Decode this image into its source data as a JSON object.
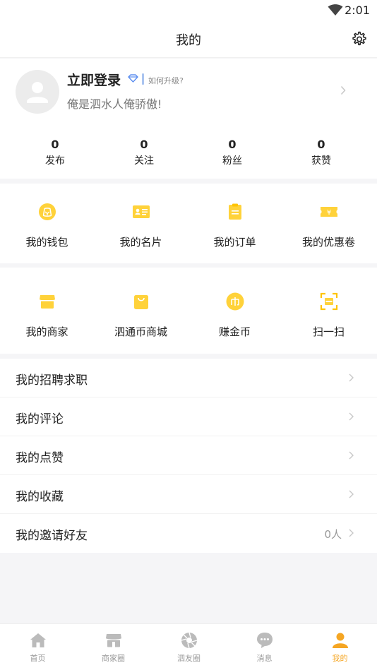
{
  "status_bar": {
    "time": "2:01"
  },
  "header": {
    "title": "我的"
  },
  "profile": {
    "name": "立即登录",
    "upgrade": "如何升级?",
    "motto": "俺是泗水人俺骄傲!"
  },
  "stats": [
    {
      "value": "0",
      "label": "发布"
    },
    {
      "value": "0",
      "label": "关注"
    },
    {
      "value": "0",
      "label": "粉丝"
    },
    {
      "value": "0",
      "label": "获赞"
    }
  ],
  "grid1": [
    {
      "label": "我的钱包",
      "icon": "wallet-icon"
    },
    {
      "label": "我的名片",
      "icon": "card-icon"
    },
    {
      "label": "我的订单",
      "icon": "order-icon"
    },
    {
      "label": "我的优惠卷",
      "icon": "coupon-icon"
    }
  ],
  "grid2": [
    {
      "label": "我的商家",
      "icon": "store-icon"
    },
    {
      "label": "泗通币商城",
      "icon": "shopping-bag-icon"
    },
    {
      "label": "赚金币",
      "icon": "coin-icon"
    },
    {
      "label": "扫一扫",
      "icon": "scan-icon"
    }
  ],
  "menu": [
    {
      "label": "我的招聘求职",
      "value": ""
    },
    {
      "label": "我的评论",
      "value": ""
    },
    {
      "label": "我的点赞",
      "value": ""
    },
    {
      "label": "我的收藏",
      "value": ""
    },
    {
      "label": "我的邀请好友",
      "value": "0人"
    }
  ],
  "tabs": [
    {
      "label": "首页",
      "icon": "home-icon"
    },
    {
      "label": "商家圈",
      "icon": "store-icon"
    },
    {
      "label": "泗友圈",
      "icon": "aperture-icon"
    },
    {
      "label": "消息",
      "icon": "chat-icon"
    },
    {
      "label": "我的",
      "icon": "person-icon",
      "active": true
    }
  ],
  "colors": {
    "accent": "#f5a623",
    "icon_yellow": "#ffd23a",
    "inactive": "#bbbbbb"
  }
}
